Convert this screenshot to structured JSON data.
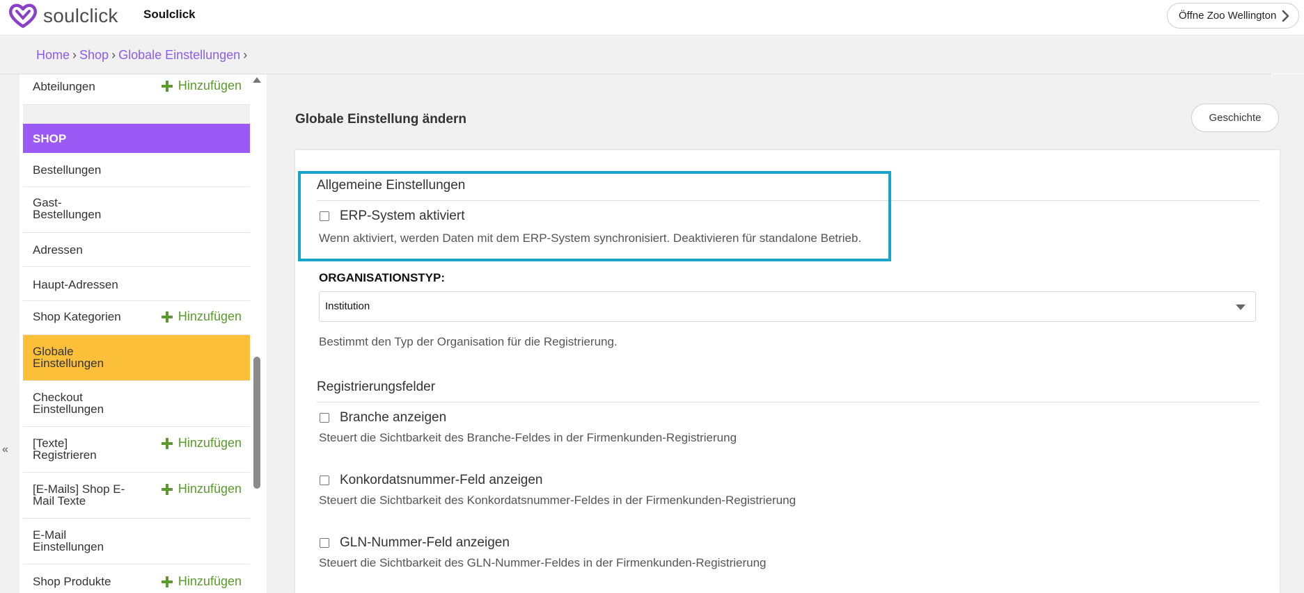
{
  "header": {
    "logo_text": "soulclick",
    "app_name": "Soulclick",
    "open_zoo_label": "Öffne Zoo Wellington",
    "brand_color": "#8b3fc9"
  },
  "breadcrumb": {
    "items": [
      "Home",
      "Shop",
      "Globale Einstellungen"
    ],
    "separator": "›"
  },
  "sidebar": {
    "collapse_label": "«",
    "add_label": "Hinzufügen",
    "section_header": "SHOP",
    "top_item": {
      "label": "Abteilungen",
      "has_add": true
    },
    "items": [
      {
        "label": "Bestellungen",
        "has_add": false,
        "active": false
      },
      {
        "label": "Gast-\nBestellungen",
        "has_add": false,
        "active": false
      },
      {
        "label": "Adressen",
        "has_add": false,
        "active": false
      },
      {
        "label": "Haupt-Adressen",
        "has_add": false,
        "active": false
      },
      {
        "label": "Shop Kategorien",
        "has_add": true,
        "active": false
      },
      {
        "label": "Globale\nEinstellungen",
        "has_add": false,
        "active": true
      },
      {
        "label": "Checkout\nEinstellungen",
        "has_add": false,
        "active": false
      },
      {
        "label": "[Texte]\nRegistrieren",
        "has_add": true,
        "active": false
      },
      {
        "label": "[E-Mails] Shop E-\nMail Texte",
        "has_add": true,
        "active": false
      },
      {
        "label": "E-Mail\nEinstellungen",
        "has_add": false,
        "active": false
      },
      {
        "label": "Shop Produkte",
        "has_add": true,
        "active": false
      }
    ],
    "active_color": "#fbbf3a",
    "header_color": "#9b59f5",
    "add_color": "#5a9a2e"
  },
  "main": {
    "page_title": "Globale Einstellung ändern",
    "history_button": "Geschichte",
    "sections": {
      "general": {
        "title": "Allgemeine Einstellungen",
        "erp_label": "ERP-System aktiviert",
        "erp_checked": false,
        "erp_help": "Wenn aktiviert, werden Daten mit dem ERP-System synchronisiert. Deaktivieren für standalone Betrieb.",
        "org_type_label": "ORGANISATIONSTYP:",
        "org_type_value": "Institution",
        "org_type_help": "Bestimmt den Typ der Organisation für die Registrierung."
      },
      "registration": {
        "title": "Registrierungsfelder",
        "fields": [
          {
            "label": "Branche anzeigen",
            "checked": false,
            "help": "Steuert die Sichtbarkeit des Branche-Feldes in der Firmenkunden-Registrierung"
          },
          {
            "label": "Konkordatsnummer-Feld anzeigen",
            "checked": false,
            "help": "Steuert die Sichtbarkeit des Konkordatsnummer-Feldes in der Firmenkunden-Registrierung"
          },
          {
            "label": "GLN-Nummer-Feld anzeigen",
            "checked": false,
            "help": "Steuert die Sichtbarkeit des GLN-Nummer-Feldes in der Firmenkunden-Registrierung"
          }
        ]
      }
    },
    "highlight_color": "#1aa3c8"
  }
}
